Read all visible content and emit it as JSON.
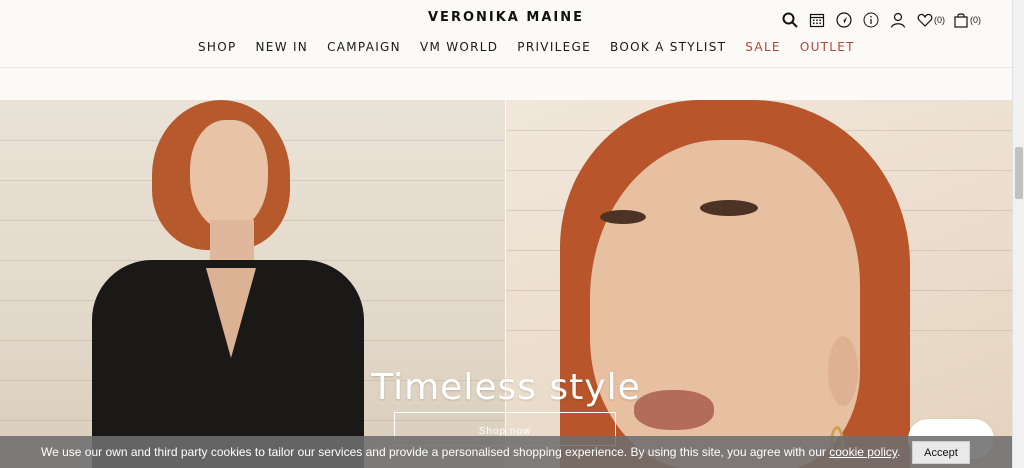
{
  "brand": "VERONIKA MAINE",
  "nav": [
    {
      "label": "SHOP",
      "color": "#1a1a1a"
    },
    {
      "label": "NEW IN",
      "color": "#1a1a1a"
    },
    {
      "label": "CAMPAIGN",
      "color": "#1a1a1a"
    },
    {
      "label": "VM WORLD",
      "color": "#1a1a1a"
    },
    {
      "label": "PRIVILEGE",
      "color": "#1a1a1a"
    },
    {
      "label": "BOOK A STYLIST",
      "color": "#1a1a1a"
    },
    {
      "label": "SALE",
      "color": "#b2463a"
    },
    {
      "label": "OUTLET",
      "color": "#b2463a"
    }
  ],
  "header_icons": {
    "search": "search-icon",
    "calendar": "calendar-icon",
    "location": "location-icon",
    "info": "info-icon",
    "account": "user-icon",
    "wishlist": "heart-icon",
    "wishlist_count": "(0)",
    "cart": "bag-icon",
    "cart_count": "(0)"
  },
  "hero": {
    "title": "Timeless style",
    "button_label": "Shop now"
  },
  "cookie": {
    "text": "We use our own and third party cookies to tailor our services and provide a personalised shopping experience. By using this site, you agree with our ",
    "link": "cookie policy",
    "suffix": ".",
    "accept_label": "Accept"
  }
}
